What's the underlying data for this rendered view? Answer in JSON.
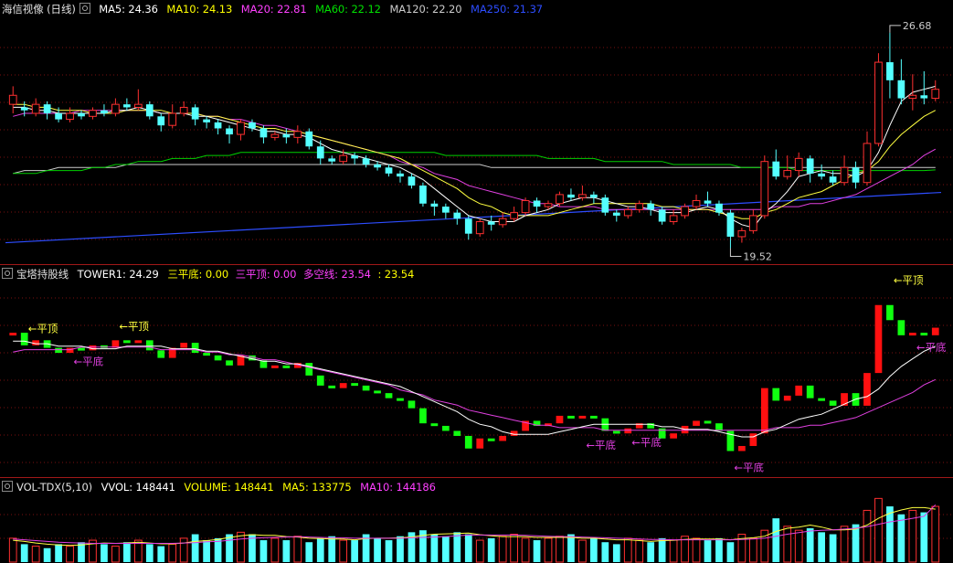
{
  "kline": {
    "title": "海信视像 (日线)",
    "ma": [
      {
        "label": "MA5: 24.36",
        "color": "#ffffff"
      },
      {
        "label": "MA10: 24.13",
        "color": "#ffff00"
      },
      {
        "label": "MA20: 22.81",
        "color": "#ff40ff"
      },
      {
        "label": "MA60: 22.12",
        "color": "#00e000"
      },
      {
        "label": "MA120: 22.20",
        "color": "#cccccc"
      },
      {
        "label": "MA250: 21.37",
        "color": "#2d4dff"
      }
    ],
    "high_label": "26.68",
    "low_label": "19.52"
  },
  "tower": {
    "title": "宝塔持股线",
    "items": [
      {
        "label": "TOWER1: 24.29",
        "color": "#ffffff"
      },
      {
        "label": "三平底: 0.00",
        "color": "#ffff00"
      },
      {
        "label": "三平顶: 0.00",
        "color": "#ff40ff"
      },
      {
        "label": "多空线: 23.54",
        "color": "#ff40ff"
      },
      {
        "label": ": 23.54",
        "color": "#ffff00"
      }
    ],
    "annotations": {
      "top": "←平顶",
      "bottom": "←平底"
    }
  },
  "volume": {
    "title": "VOL-TDX(5,10)",
    "items": [
      {
        "label": "VVOL: 148441",
        "color": "#ffffff"
      },
      {
        "label": "VOLUME: 148441",
        "color": "#ffff00"
      },
      {
        "label": "MA5: 133775",
        "color": "#ffff00"
      },
      {
        "label": "MA10: 144186",
        "color": "#ff40ff"
      }
    ]
  },
  "chart_data": {
    "type": "candlestick",
    "candles": [
      [
        24.3,
        24.6,
        24.9,
        24.0
      ],
      [
        24.2,
        24.1,
        24.4,
        23.9
      ],
      [
        24.0,
        24.3,
        24.5,
        23.9
      ],
      [
        24.3,
        24.0,
        24.4,
        23.8
      ],
      [
        24.0,
        23.8,
        24.2,
        23.7
      ],
      [
        23.8,
        24.0,
        24.2,
        23.7
      ],
      [
        24.0,
        23.9,
        24.1,
        23.8
      ],
      [
        23.9,
        24.1,
        24.2,
        23.8
      ],
      [
        24.1,
        24.0,
        24.3,
        23.9
      ],
      [
        24.0,
        24.3,
        24.5,
        23.9
      ],
      [
        24.3,
        24.2,
        24.5,
        24.1
      ],
      [
        24.2,
        24.3,
        24.8,
        24.1
      ],
      [
        24.3,
        23.9,
        24.4,
        23.8
      ],
      [
        23.9,
        23.6,
        24.0,
        23.4
      ],
      [
        23.6,
        24.0,
        24.3,
        23.5
      ],
      [
        24.0,
        24.2,
        24.4,
        23.9
      ],
      [
        24.2,
        23.8,
        24.3,
        23.6
      ],
      [
        23.8,
        23.7,
        23.9,
        23.5
      ],
      [
        23.7,
        23.5,
        23.8,
        23.3
      ],
      [
        23.5,
        23.3,
        23.6,
        23.0
      ],
      [
        23.3,
        23.7,
        23.8,
        23.1
      ],
      [
        23.7,
        23.5,
        23.8,
        23.4
      ],
      [
        23.5,
        23.2,
        23.6,
        23.0
      ],
      [
        23.2,
        23.3,
        23.4,
        23.1
      ],
      [
        23.3,
        23.2,
        23.5,
        23.0
      ],
      [
        23.2,
        23.4,
        23.6,
        23.0
      ],
      [
        23.4,
        22.9,
        23.5,
        22.8
      ],
      [
        22.9,
        22.5,
        23.1,
        22.3
      ],
      [
        22.5,
        22.4,
        22.6,
        22.3
      ],
      [
        22.4,
        22.6,
        22.8,
        22.3
      ],
      [
        22.6,
        22.5,
        22.7,
        22.3
      ],
      [
        22.5,
        22.3,
        22.6,
        22.2
      ],
      [
        22.3,
        22.2,
        22.4,
        22.1
      ],
      [
        22.2,
        22.0,
        22.3,
        21.9
      ],
      [
        22.0,
        21.9,
        22.1,
        21.7
      ],
      [
        21.9,
        21.6,
        22.0,
        21.5
      ],
      [
        21.6,
        21.0,
        21.7,
        20.9
      ],
      [
        21.0,
        20.9,
        21.1,
        20.6
      ],
      [
        20.9,
        20.7,
        21.0,
        20.5
      ],
      [
        20.7,
        20.5,
        20.8,
        20.3
      ],
      [
        20.5,
        20.0,
        20.6,
        19.8
      ],
      [
        20.0,
        20.4,
        20.5,
        19.9
      ],
      [
        20.4,
        20.3,
        20.6,
        20.1
      ],
      [
        20.3,
        20.5,
        20.7,
        20.2
      ],
      [
        20.5,
        20.7,
        20.9,
        20.4
      ],
      [
        20.7,
        21.1,
        21.2,
        20.6
      ],
      [
        21.1,
        20.9,
        21.2,
        20.7
      ],
      [
        20.9,
        21.0,
        21.1,
        20.8
      ],
      [
        21.0,
        21.3,
        21.4,
        20.9
      ],
      [
        21.3,
        21.2,
        21.5,
        21.1
      ],
      [
        21.2,
        21.3,
        21.6,
        21.1
      ],
      [
        21.3,
        21.2,
        21.4,
        21.0
      ],
      [
        21.2,
        20.7,
        21.3,
        20.6
      ],
      [
        20.7,
        20.6,
        20.8,
        20.4
      ],
      [
        20.6,
        20.8,
        20.9,
        20.5
      ],
      [
        20.8,
        21.0,
        21.1,
        20.7
      ],
      [
        21.0,
        20.8,
        21.1,
        20.6
      ],
      [
        20.8,
        20.4,
        20.9,
        20.3
      ],
      [
        20.4,
        20.6,
        20.8,
        20.3
      ],
      [
        20.6,
        20.9,
        21.0,
        20.5
      ],
      [
        20.9,
        21.1,
        21.3,
        20.8
      ],
      [
        21.1,
        21.0,
        21.4,
        20.9
      ],
      [
        21.0,
        20.7,
        21.1,
        20.6
      ],
      [
        20.7,
        19.9,
        20.8,
        19.52
      ],
      [
        19.9,
        20.1,
        20.2,
        19.7
      ],
      [
        20.1,
        20.6,
        20.8,
        20.0
      ],
      [
        20.6,
        22.4,
        22.6,
        20.5
      ],
      [
        22.4,
        21.9,
        22.8,
        21.8
      ],
      [
        21.9,
        22.1,
        22.6,
        21.8
      ],
      [
        22.1,
        22.5,
        22.7,
        21.9
      ],
      [
        22.5,
        22.0,
        22.6,
        21.7
      ],
      [
        22.0,
        21.9,
        22.3,
        21.8
      ],
      [
        21.9,
        21.7,
        22.1,
        21.6
      ],
      [
        21.7,
        22.2,
        22.6,
        21.6
      ],
      [
        22.2,
        21.7,
        22.4,
        21.5
      ],
      [
        21.7,
        23.0,
        23.4,
        21.6
      ],
      [
        23.0,
        25.7,
        26.0,
        22.9
      ],
      [
        25.7,
        25.1,
        26.68,
        24.5
      ],
      [
        25.1,
        24.5,
        25.8,
        24.3
      ],
      [
        24.5,
        24.6,
        25.3,
        24.1
      ],
      [
        24.6,
        24.5,
        25.4,
        24.3
      ],
      [
        24.5,
        24.8,
        25.1,
        24.4
      ]
    ],
    "y_range": [
      19.2,
      27.1
    ],
    "ma5": [
      24.2,
      24.2,
      24.1,
      24.1,
      24.0,
      24.0,
      24.0,
      24.0,
      24.0,
      24.1,
      24.1,
      24.2,
      24.1,
      24.0,
      24.0,
      24.0,
      23.9,
      23.9,
      23.8,
      23.7,
      23.6,
      23.5,
      23.4,
      23.4,
      23.3,
      23.3,
      23.2,
      23.0,
      22.8,
      22.7,
      22.6,
      22.5,
      22.4,
      22.3,
      22.2,
      22.0,
      21.8,
      21.5,
      21.2,
      20.9,
      20.6,
      20.5,
      20.4,
      20.4,
      20.4,
      20.6,
      20.7,
      20.8,
      21.0,
      21.1,
      21.2,
      21.2,
      21.1,
      21.0,
      20.9,
      20.9,
      20.8,
      20.7,
      20.7,
      20.7,
      20.8,
      20.9,
      20.8,
      20.5,
      20.3,
      20.2,
      20.7,
      21.0,
      21.4,
      21.9,
      22.0,
      22.1,
      22.0,
      22.0,
      21.9,
      22.1,
      22.7,
      23.6,
      24.4,
      24.7,
      24.8,
      24.9
    ],
    "ma10": [
      24.3,
      24.3,
      24.2,
      24.2,
      24.1,
      24.1,
      24.1,
      24.0,
      24.0,
      24.0,
      24.1,
      24.1,
      24.1,
      24.1,
      24.0,
      24.0,
      24.0,
      23.9,
      23.9,
      23.8,
      23.7,
      23.6,
      23.5,
      23.5,
      23.4,
      23.4,
      23.3,
      23.2,
      23.1,
      23.0,
      22.9,
      22.8,
      22.7,
      22.6,
      22.5,
      22.3,
      22.1,
      21.9,
      21.7,
      21.5,
      21.2,
      21.0,
      20.9,
      20.7,
      20.6,
      20.6,
      20.6,
      20.6,
      20.7,
      20.8,
      20.9,
      21.0,
      21.0,
      21.0,
      21.0,
      21.0,
      21.0,
      20.9,
      20.9,
      20.8,
      20.8,
      20.8,
      20.7,
      20.6,
      20.5,
      20.5,
      20.7,
      20.8,
      21.0,
      21.2,
      21.3,
      21.4,
      21.6,
      21.8,
      22.0,
      22.1,
      22.4,
      22.9,
      23.3,
      23.6,
      23.9,
      24.1
    ],
    "ma20": [
      23.9,
      24.0,
      24.0,
      24.0,
      24.0,
      24.0,
      24.1,
      24.1,
      24.1,
      24.1,
      24.1,
      24.1,
      24.1,
      24.0,
      24.0,
      24.0,
      24.0,
      23.9,
      23.9,
      23.8,
      23.8,
      23.7,
      23.6,
      23.6,
      23.5,
      23.4,
      23.3,
      23.2,
      23.1,
      23.0,
      22.9,
      22.8,
      22.7,
      22.6,
      22.4,
      22.3,
      22.2,
      22.0,
      21.9,
      21.8,
      21.6,
      21.5,
      21.4,
      21.3,
      21.2,
      21.1,
      21.0,
      21.0,
      20.9,
      20.9,
      20.9,
      20.9,
      20.8,
      20.8,
      20.8,
      20.8,
      20.8,
      20.8,
      20.8,
      20.8,
      20.8,
      20.8,
      20.8,
      20.8,
      20.8,
      20.8,
      20.8,
      20.9,
      20.9,
      20.9,
      21.0,
      21.0,
      21.1,
      21.2,
      21.3,
      21.5,
      21.7,
      21.9,
      22.1,
      22.3,
      22.6,
      22.81
    ],
    "ma60": [
      22.0,
      22.0,
      22.0,
      22.1,
      22.1,
      22.1,
      22.1,
      22.2,
      22.2,
      22.3,
      22.3,
      22.4,
      22.4,
      22.4,
      22.5,
      22.5,
      22.5,
      22.6,
      22.6,
      22.6,
      22.7,
      22.7,
      22.7,
      22.7,
      22.7,
      22.7,
      22.7,
      22.7,
      22.7,
      22.7,
      22.7,
      22.7,
      22.7,
      22.7,
      22.7,
      22.7,
      22.7,
      22.7,
      22.6,
      22.6,
      22.6,
      22.6,
      22.6,
      22.6,
      22.6,
      22.6,
      22.6,
      22.5,
      22.5,
      22.5,
      22.5,
      22.5,
      22.4,
      22.4,
      22.4,
      22.4,
      22.4,
      22.4,
      22.3,
      22.3,
      22.3,
      22.3,
      22.3,
      22.3,
      22.2,
      22.2,
      22.2,
      22.2,
      22.2,
      22.1,
      22.1,
      22.1,
      22.1,
      22.1,
      22.1,
      22.1,
      22.1,
      22.1,
      22.1,
      22.1,
      22.1,
      22.12
    ],
    "ma120": [
      22.0,
      22.1,
      22.1,
      22.1,
      22.2,
      22.2,
      22.2,
      22.2,
      22.2,
      22.2,
      22.3,
      22.3,
      22.3,
      22.3,
      22.3,
      22.3,
      22.3,
      22.3,
      22.3,
      22.3,
      22.3,
      22.3,
      22.3,
      22.3,
      22.3,
      22.3,
      22.3,
      22.3,
      22.3,
      22.3,
      22.3,
      22.3,
      22.3,
      22.3,
      22.3,
      22.3,
      22.3,
      22.3,
      22.3,
      22.3,
      22.3,
      22.3,
      22.2,
      22.2,
      22.2,
      22.2,
      22.2,
      22.2,
      22.2,
      22.2,
      22.2,
      22.2,
      22.2,
      22.2,
      22.2,
      22.2,
      22.2,
      22.2,
      22.2,
      22.2,
      22.2,
      22.2,
      22.2,
      22.2,
      22.2,
      22.2,
      22.2,
      22.2,
      22.2,
      22.2,
      22.2,
      22.2,
      22.2,
      22.2,
      22.2,
      22.2,
      22.2,
      22.2,
      22.2,
      22.2,
      22.2,
      22.2
    ],
    "ma250_range": [
      19.7,
      21.37
    ],
    "tower": [
      [
        1,
        0
      ],
      [
        1,
        0
      ],
      [
        0,
        1
      ],
      [
        1,
        0
      ],
      [
        1,
        0
      ],
      [
        0,
        1
      ],
      [
        0,
        1
      ],
      [
        1,
        0
      ],
      [
        1,
        0
      ],
      [
        1,
        0
      ],
      [
        1,
        0
      ],
      [
        0,
        1
      ],
      [
        0,
        1
      ],
      [
        1,
        0
      ],
      [
        0,
        1
      ],
      [
        0,
        1
      ],
      [
        0,
        1
      ],
      [
        0,
        1
      ],
      [
        0,
        1
      ],
      [
        0,
        1
      ],
      [
        0,
        1
      ],
      [
        0,
        1
      ],
      [
        0,
        1
      ],
      [
        0,
        1
      ],
      [
        0,
        1
      ],
      [
        0,
        1
      ],
      [
        0,
        1
      ],
      [
        0,
        1
      ],
      [
        0,
        1
      ],
      [
        0,
        1
      ],
      [
        0,
        1
      ],
      [
        0,
        1
      ],
      [
        0,
        1
      ],
      [
        0,
        1
      ],
      [
        0,
        1
      ],
      [
        0,
        1
      ],
      [
        1,
        0
      ],
      [
        1,
        0
      ],
      [
        1,
        0
      ],
      [
        1,
        0
      ],
      [
        1,
        0
      ],
      [
        0,
        1
      ],
      [
        0,
        1
      ],
      [
        0,
        1
      ],
      [
        0,
        1
      ],
      [
        0,
        1
      ],
      [
        1,
        0
      ],
      [
        1,
        0
      ],
      [
        1,
        0
      ],
      [
        1,
        0
      ],
      [
        0,
        1
      ],
      [
        0,
        1
      ],
      [
        0,
        1
      ],
      [
        0,
        1
      ],
      [
        1,
        0
      ],
      [
        1,
        0
      ],
      [
        1,
        0
      ],
      [
        1,
        0
      ],
      [
        1,
        0
      ],
      [
        1,
        0
      ],
      [
        1,
        0
      ],
      [
        1,
        0
      ],
      [
        1,
        0
      ],
      [
        1,
        0
      ],
      [
        1,
        0
      ],
      [
        1,
        0
      ],
      [
        1,
        0
      ],
      [
        0,
        1
      ],
      [
        0,
        1
      ],
      [
        1,
        0
      ],
      [
        1,
        0
      ],
      [
        0,
        1
      ],
      [
        0,
        1
      ],
      [
        0,
        1
      ],
      [
        0,
        1
      ],
      [
        0,
        1
      ],
      [
        0,
        1
      ],
      [
        0,
        1
      ],
      [
        0,
        1
      ],
      [
        0,
        1
      ]
    ],
    "volume": [
      60,
      45,
      40,
      35,
      45,
      40,
      50,
      55,
      45,
      40,
      50,
      55,
      45,
      40,
      45,
      60,
      70,
      55,
      60,
      70,
      75,
      70,
      55,
      60,
      55,
      65,
      50,
      60,
      65,
      55,
      55,
      70,
      60,
      55,
      65,
      75,
      80,
      70,
      65,
      75,
      70,
      55,
      60,
      65,
      70,
      60,
      55,
      60,
      65,
      70,
      55,
      60,
      50,
      45,
      60,
      55,
      50,
      60,
      55,
      65,
      60,
      55,
      60,
      50,
      70,
      60,
      80,
      110,
      90,
      80,
      85,
      75,
      70,
      90,
      95,
      130,
      160,
      140,
      120,
      130,
      125,
      140
    ],
    "volume_ma5": [
      55,
      52,
      48,
      45,
      43,
      42,
      43,
      46,
      48,
      47,
      48,
      50,
      48,
      46,
      46,
      48,
      52,
      54,
      57,
      62,
      66,
      69,
      67,
      67,
      64,
      63,
      60,
      59,
      58,
      58,
      56,
      59,
      60,
      60,
      61,
      63,
      67,
      70,
      71,
      72,
      73,
      69,
      66,
      64,
      64,
      64,
      62,
      62,
      62,
      62,
      60,
      60,
      58,
      56,
      56,
      54,
      52,
      54,
      55,
      57,
      58,
      58,
      58,
      56,
      59,
      61,
      65,
      77,
      85,
      88,
      93,
      88,
      81,
      81,
      83,
      93,
      110,
      123,
      131,
      137,
      137,
      133
    ],
    "volume_ma10": [
      58,
      56,
      54,
      52,
      50,
      49,
      48,
      47,
      47,
      47,
      47,
      47,
      47,
      47,
      47,
      48,
      49,
      51,
      52,
      55,
      58,
      60,
      61,
      62,
      63,
      64,
      63,
      62,
      61,
      61,
      60,
      60,
      60,
      60,
      60,
      61,
      62,
      63,
      64,
      66,
      68,
      68,
      68,
      68,
      68,
      67,
      66,
      65,
      64,
      64,
      63,
      62,
      61,
      60,
      59,
      58,
      57,
      57,
      56,
      56,
      56,
      56,
      56,
      56,
      57,
      58,
      60,
      65,
      70,
      74,
      78,
      80,
      81,
      83,
      85,
      89,
      95,
      101,
      105,
      110,
      115,
      144
    ]
  }
}
